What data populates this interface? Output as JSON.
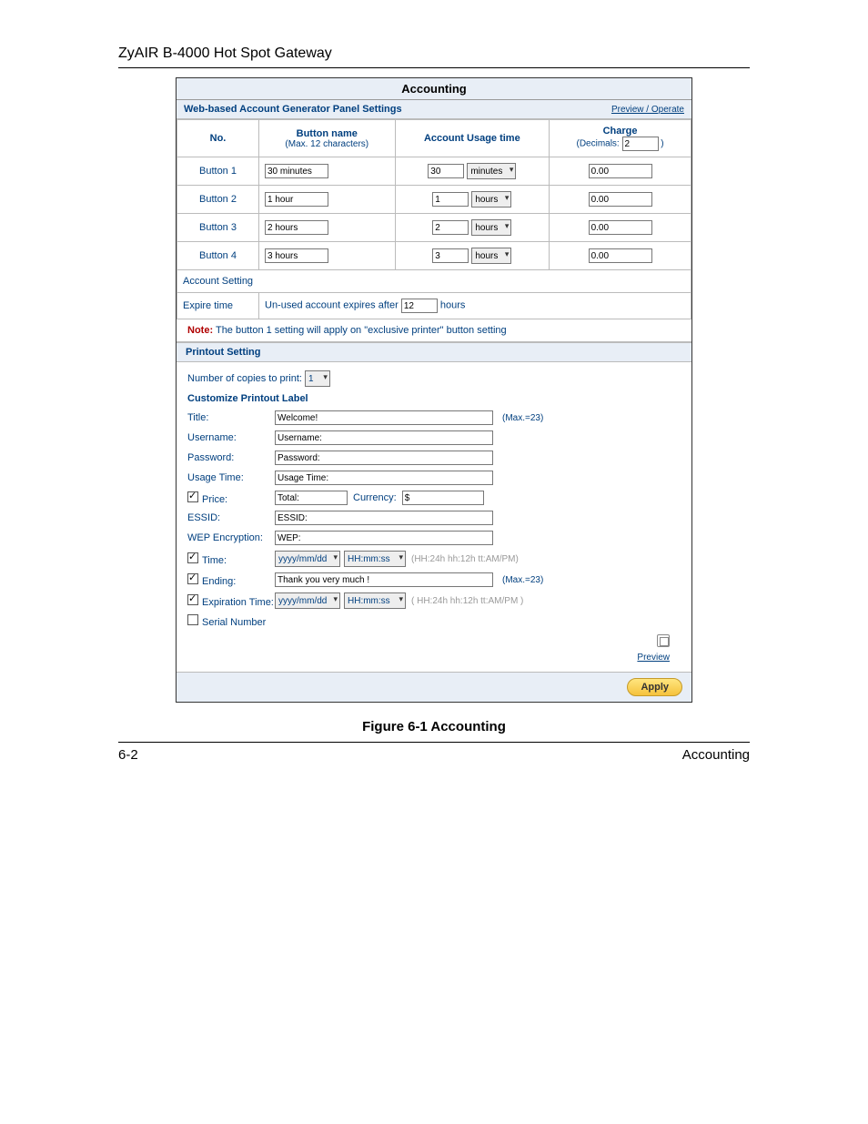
{
  "doc": {
    "header": "ZyAIR B-4000 Hot Spot Gateway",
    "caption": "Figure 6-1 Accounting",
    "footer_left": "6-2",
    "footer_right": "Accounting"
  },
  "panel": {
    "title": "Accounting",
    "sub_title": "Web-based Account Generator Panel Settings",
    "preview_operate": "Preview / Operate"
  },
  "headers": {
    "no": "No.",
    "button_name": "Button name",
    "button_name_hint": "(Max. 12 characters)",
    "usage": "Account Usage time",
    "charge": "Charge",
    "decimals_label": "(Decimals:",
    "decimals_value": "2",
    "decimals_close": ")"
  },
  "rows": [
    {
      "label": "Button 1",
      "name": "30 minutes",
      "num": "30",
      "unit": "minutes",
      "charge": "0.00"
    },
    {
      "label": "Button 2",
      "name": "1 hour",
      "num": "1",
      "unit": "hours",
      "charge": "0.00"
    },
    {
      "label": "Button 3",
      "name": "2 hours",
      "num": "2",
      "unit": "hours",
      "charge": "0.00"
    },
    {
      "label": "Button 4",
      "name": "3 hours",
      "num": "3",
      "unit": "hours",
      "charge": "0.00"
    }
  ],
  "account_setting": {
    "header": "Account Setting",
    "expire_label": "Expire time",
    "expire_text_pre": "Un-used account expires after",
    "expire_value": "12",
    "expire_text_post": "hours"
  },
  "note": {
    "prefix": "Note:",
    "text": " The button 1 setting will apply on \"exclusive printer\" button setting"
  },
  "printout": {
    "header": "Printout Setting",
    "copies_label": "Number of copies to print:",
    "copies_value": "1",
    "customize": "Customize Printout Label",
    "fields": {
      "title_label": "Title:",
      "title_value": "Welcome!",
      "title_max": "(Max.=23)",
      "username_label": "Username:",
      "username_value": "Username:",
      "password_label": "Password:",
      "password_value": "Password:",
      "usage_label": "Usage Time:",
      "usage_value": "Usage Time:",
      "price_label": "Price:",
      "price_value": "Total:",
      "currency_label": "Currency:",
      "currency_value": "$",
      "essid_label": "ESSID:",
      "essid_value": "ESSID:",
      "wep_label": "WEP Encryption:",
      "wep_value": "WEP:",
      "time_label": "Time:",
      "time_date": "yyyy/mm/dd",
      "time_time": "HH:mm:ss",
      "time_note": "(HH:24h hh:12h tt:AM/PM)",
      "ending_label": "Ending:",
      "ending_value": "Thank you very much !",
      "ending_max": "(Max.=23)",
      "exp_label": "Expiration Time:",
      "exp_date": "yyyy/mm/dd",
      "exp_time": "HH:mm:ss",
      "exp_note": "( HH:24h hh:12h tt:AM/PM )",
      "serial_label": "Serial Number"
    },
    "preview": "Preview"
  },
  "apply": "Apply"
}
